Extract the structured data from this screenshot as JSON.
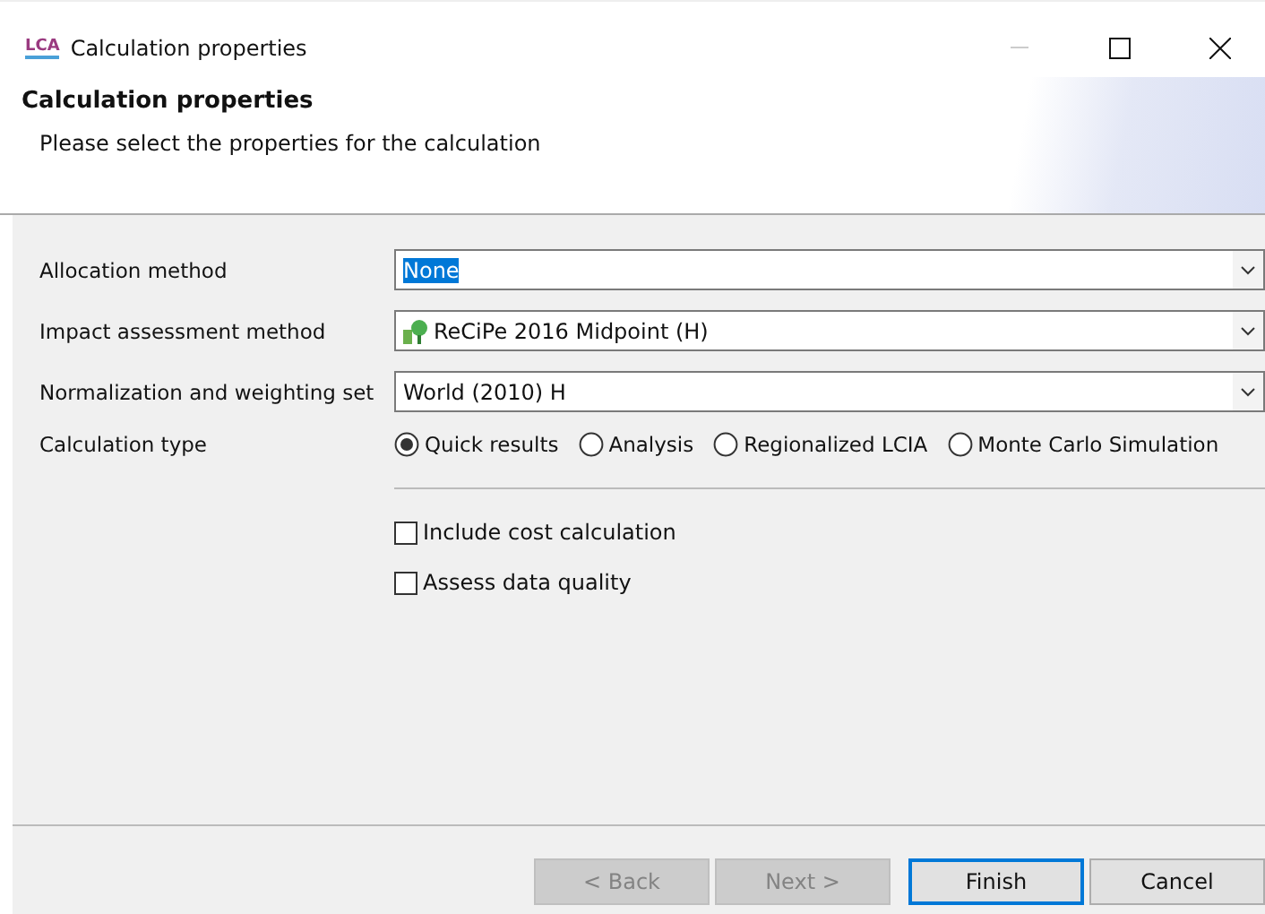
{
  "window": {
    "title": "Calculation properties",
    "logo": "LCA"
  },
  "header": {
    "title": "Calculation properties",
    "description": "Please select the properties for the calculation"
  },
  "fields": [
    {
      "label": "Allocation method",
      "value": "None",
      "text_selected": true,
      "has_icon": false
    },
    {
      "label": "Impact assessment method",
      "value": "ReCiPe 2016 Midpoint (H)",
      "text_selected": false,
      "has_icon": true
    },
    {
      "label": "Normalization and weighting set",
      "value": "World (2010) H",
      "text_selected": false,
      "has_icon": false
    }
  ],
  "calculation_type": {
    "label": "Calculation type",
    "options": [
      {
        "label": "Quick results",
        "selected": true
      },
      {
        "label": "Analysis",
        "selected": false
      },
      {
        "label": "Regionalized LCIA",
        "selected": false
      },
      {
        "label": "Monte Carlo Simulation",
        "selected": false
      }
    ]
  },
  "options": [
    {
      "label": "Include cost calculation",
      "checked": false
    },
    {
      "label": "Assess data quality",
      "checked": false
    }
  ],
  "buttons": [
    {
      "label": "< Back",
      "disabled": true,
      "default": false
    },
    {
      "label": "Next >",
      "disabled": true,
      "default": false
    },
    {
      "label": "Finish",
      "disabled": false,
      "default": true
    },
    {
      "label": "Cancel",
      "disabled": false,
      "default": false
    }
  ]
}
